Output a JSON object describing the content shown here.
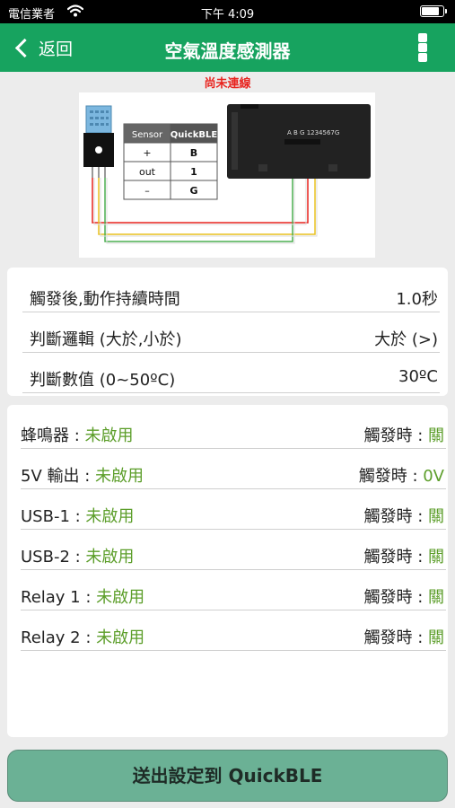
{
  "status_bar": {
    "carrier": "電信業者",
    "time": "下午 4:09",
    "battery_level": 0.9
  },
  "navbar": {
    "back_label": "返回",
    "title": "空氣溫度感測器",
    "menu_icon": "more-vertical-icon"
  },
  "connection_status": "尚未連線",
  "wiring_diagram": {
    "table_headers": [
      "Sensor",
      "QuickBLE"
    ],
    "table_rows": [
      [
        "+",
        "B"
      ],
      [
        "out",
        "1"
      ],
      [
        "–",
        "G"
      ]
    ],
    "board_label": "A B G 1234567G",
    "wire_colors": [
      "#e8231e",
      "#e8c11e",
      "#4caf50"
    ]
  },
  "settings": [
    {
      "label": "觸發後,動作持續時間",
      "value": "1.0秒"
    },
    {
      "label": "判斷邏輯 (大於,小於)",
      "value": "大於 (>)"
    },
    {
      "label": "判斷數值 (0~50ºC)",
      "value": "30ºC"
    }
  ],
  "outputs": [
    {
      "name": "蜂鳴器 : ",
      "state": "未啟用",
      "trigger_label": "觸發時 : ",
      "trigger_value": "關"
    },
    {
      "name": "5V 輸出 : ",
      "state": "未啟用",
      "trigger_label": "觸發時 : ",
      "trigger_value": "0V"
    },
    {
      "name": "USB-1 : ",
      "state": "未啟用",
      "trigger_label": "觸發時 : ",
      "trigger_value": "關"
    },
    {
      "name": "USB-2 : ",
      "state": "未啟用",
      "trigger_label": "觸發時 : ",
      "trigger_value": "關"
    },
    {
      "name": "Relay 1 : ",
      "state": "未啟用",
      "trigger_label": "觸發時 : ",
      "trigger_value": "關"
    },
    {
      "name": "Relay 2 : ",
      "state": "未啟用",
      "trigger_label": "觸發時 : ",
      "trigger_value": "關"
    }
  ],
  "send_button": "送出設定到 QuickBLE",
  "colors": {
    "nav_green": "#17a35f",
    "value_green": "#5c9e2a",
    "alert_red": "#e8231e",
    "button": "#6bb195"
  }
}
